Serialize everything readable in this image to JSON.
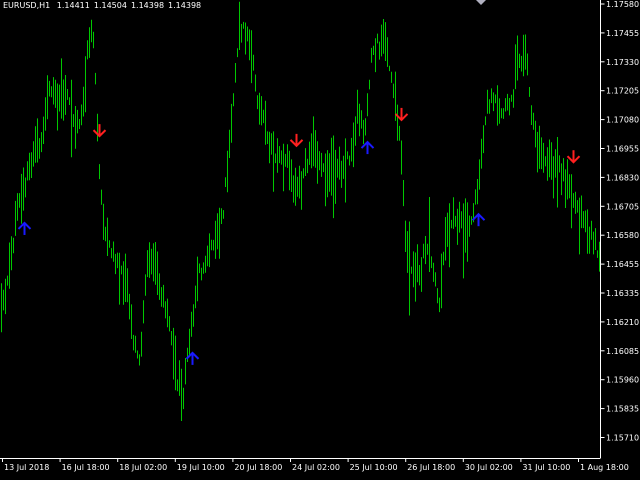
{
  "header": {
    "symbol": "EURUSD,H1",
    "open": "1.14411",
    "high": "1.14504",
    "low": "1.14398",
    "close": "1.14398"
  },
  "colors": {
    "background": "#000000",
    "candle": "#00c800",
    "axis": "#ffffff",
    "arrow_up": "#1a1aff",
    "arrow_down": "#ff2020",
    "top_marker": "#b0b0c0"
  },
  "chart_data": {
    "type": "bar",
    "style": "ohlc-hl-bars",
    "symbol": "EURUSD",
    "timeframe": "H1",
    "y_ticks": [
      "1.17580",
      "1.17455",
      "1.17330",
      "1.17205",
      "1.17080",
      "1.16955",
      "1.16830",
      "1.16705",
      "1.16580",
      "1.16455",
      "1.16335",
      "1.16210",
      "1.16085",
      "1.15960",
      "1.15835",
      "1.15710"
    ],
    "y_range": [
      1.1566,
      1.1763
    ],
    "x_ticks": [
      "13 Jul 2018",
      "16 Jul 18:00",
      "18 Jul 02:00",
      "19 Jul 10:00",
      "20 Jul 18:00",
      "24 Jul 02:00",
      "25 Jul 10:00",
      "26 Jul 18:00",
      "30 Jul 02:00",
      "31 Jul 10:00",
      "1 Aug 18:00"
    ],
    "keypoints": [
      [
        0,
        1.1625
      ],
      [
        7,
        1.164
      ],
      [
        17,
        1.167
      ],
      [
        28,
        1.1685
      ],
      [
        40,
        1.17
      ],
      [
        50,
        1.1725
      ],
      [
        58,
        1.1715
      ],
      [
        66,
        1.172
      ],
      [
        74,
        1.1708
      ],
      [
        82,
        1.171
      ],
      [
        88,
        1.174
      ],
      [
        93,
        1.1745
      ],
      [
        98,
        1.169
      ],
      [
        104,
        1.166
      ],
      [
        114,
        1.165
      ],
      [
        124,
        1.164
      ],
      [
        133,
        1.1615
      ],
      [
        140,
        1.1605
      ],
      [
        148,
        1.1652
      ],
      [
        158,
        1.164
      ],
      [
        168,
        1.162
      ],
      [
        176,
        1.1598
      ],
      [
        183,
        1.159
      ],
      [
        190,
        1.1618
      ],
      [
        198,
        1.164
      ],
      [
        206,
        1.165
      ],
      [
        214,
        1.1655
      ],
      [
        222,
        1.1665
      ],
      [
        230,
        1.17
      ],
      [
        238,
        1.1745
      ],
      [
        247,
        1.1748
      ],
      [
        256,
        1.172
      ],
      [
        264,
        1.1705
      ],
      [
        274,
        1.169
      ],
      [
        282,
        1.1695
      ],
      [
        292,
        1.168
      ],
      [
        302,
        1.1682
      ],
      [
        312,
        1.17
      ],
      [
        320,
        1.1684
      ],
      [
        330,
        1.1688
      ],
      [
        340,
        1.1684
      ],
      [
        350,
        1.1695
      ],
      [
        358,
        1.171
      ],
      [
        365,
        1.1705
      ],
      [
        372,
        1.1738
      ],
      [
        380,
        1.1742
      ],
      [
        386,
        1.1738
      ],
      [
        393,
        1.172
      ],
      [
        400,
        1.17
      ],
      [
        405,
        1.166
      ],
      [
        412,
        1.164
      ],
      [
        420,
        1.1645
      ],
      [
        428,
        1.1655
      ],
      [
        434,
        1.164
      ],
      [
        440,
        1.163
      ],
      [
        446,
        1.166
      ],
      [
        455,
        1.1665
      ],
      [
        466,
        1.166
      ],
      [
        474,
        1.167
      ],
      [
        480,
        1.169
      ],
      [
        487,
        1.1715
      ],
      [
        494,
        1.1718
      ],
      [
        502,
        1.171
      ],
      [
        510,
        1.1715
      ],
      [
        518,
        1.1732
      ],
      [
        525,
        1.1738
      ],
      [
        531,
        1.1712
      ],
      [
        538,
        1.1698
      ],
      [
        546,
        1.169
      ],
      [
        555,
        1.1688
      ],
      [
        564,
        1.1685
      ],
      [
        572,
        1.1675
      ],
      [
        580,
        1.1665
      ],
      [
        588,
        1.166
      ],
      [
        594,
        1.1655
      ],
      [
        601,
        1.1645
      ]
    ],
    "signals": [
      {
        "type": "buy",
        "index": 24
      },
      {
        "type": "sell",
        "index": 99
      },
      {
        "type": "buy",
        "index": 192
      },
      {
        "type": "sell",
        "index": 296
      },
      {
        "type": "buy",
        "index": 367
      },
      {
        "type": "sell",
        "index": 401
      },
      {
        "type": "buy",
        "index": 478
      },
      {
        "type": "sell",
        "index": 573
      }
    ],
    "grid": false,
    "legend": "none"
  }
}
